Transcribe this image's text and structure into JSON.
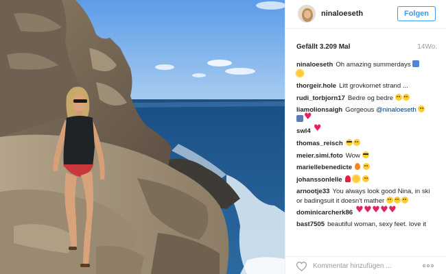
{
  "post": {
    "username": "ninaloeseth",
    "follow_label": "Folgen",
    "likes_text": "Gefällt 3.209 Mal",
    "timestamp": "14Wo."
  },
  "comments": [
    {
      "user": "ninaloeseth",
      "text": "Oh amazing summerdays",
      "emojis": [
        "wave-emoji",
        "sun-emoji"
      ]
    },
    {
      "user": "thorgeir.hole",
      "text": "Litt grovkornet strand ...",
      "emojis": []
    },
    {
      "user": "rudi_torbjorn17",
      "text": "Bedre og bedre",
      "emojis": [
        "face-emoji",
        "face-emoji"
      ]
    },
    {
      "user": "liamolionsaigh",
      "text_before": "Gorgeous ",
      "mention": "@ninaloeseth",
      "emojis": [
        "heart-eyes-emoji",
        "person-emoji",
        "heart-emoji"
      ]
    },
    {
      "user": "swl4",
      "text": "",
      "emojis": [
        "heart-emoji"
      ]
    },
    {
      "user": "thomas_reisch",
      "text": "",
      "emojis": [
        "sunglasses-emoji",
        "face-emoji"
      ]
    },
    {
      "user": "meier.simi.foto",
      "text": "Wow",
      "emojis": [
        "sunglasses-emoji"
      ]
    },
    {
      "user": "mariellebenedicte",
      "text": "",
      "emojis": [
        "flame-emoji",
        "face-emoji"
      ]
    },
    {
      "user": "johanssonlelle",
      "text": "",
      "emojis": [
        "rose-emoji",
        "sun-emoji",
        "face-emoji"
      ]
    },
    {
      "user": "arnootje33",
      "text": "You always look good Nina, in ski or badingsuit it doesn't mather",
      "emojis": [
        "face-emoji",
        "face-emoji",
        "face-emoji"
      ]
    },
    {
      "user": "dominicarcherk86",
      "text": "",
      "emojis": [
        "heart-emoji",
        "heart-emoji",
        "heart-emoji",
        "heart-emoji",
        "heart-emoji"
      ]
    },
    {
      "user": "bast7505",
      "text": "beautiful woman, sexy feet. love it",
      "emojis": []
    }
  ],
  "footer": {
    "comment_placeholder": "Kommentar hinzufügen ...",
    "like_icon": "heart-outline-icon",
    "more_icon": "more-options-icon"
  },
  "colors": {
    "accent": "#3897f0",
    "text": "#262626",
    "muted": "#999999",
    "border": "#efefef"
  }
}
